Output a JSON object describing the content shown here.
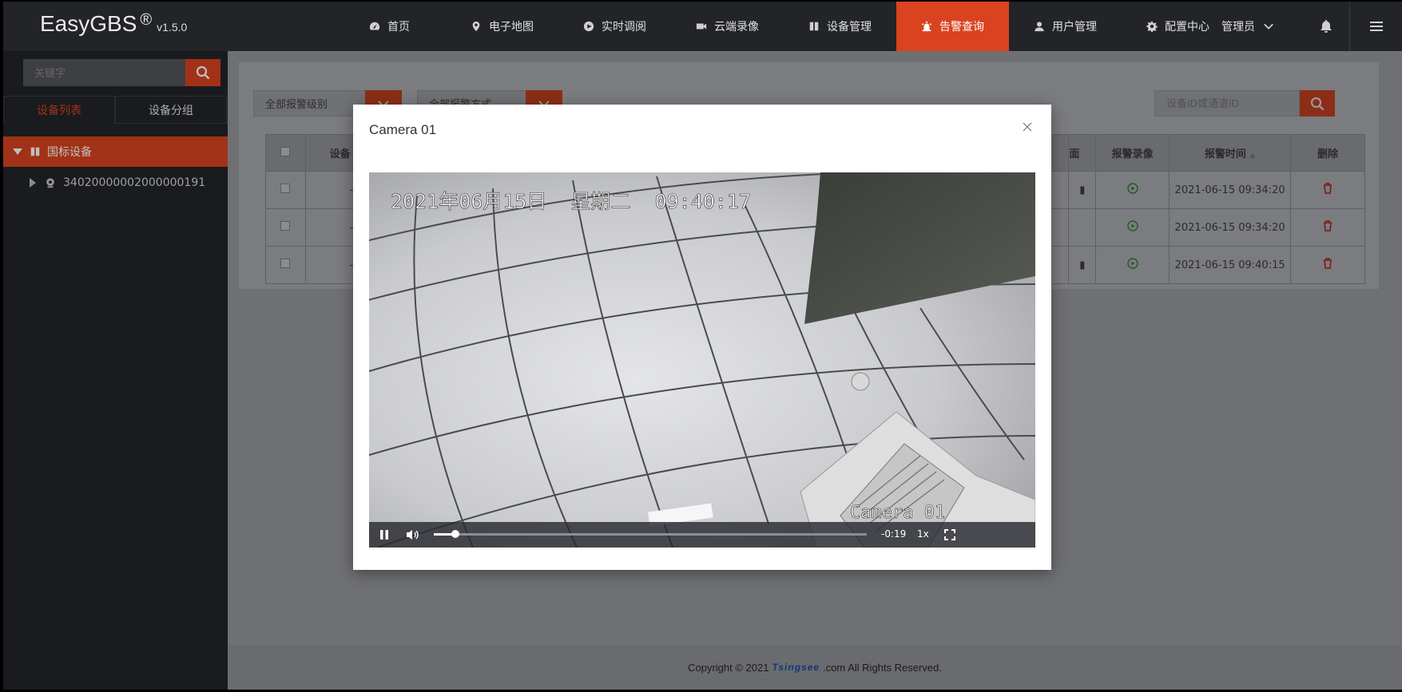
{
  "brand": {
    "name": "EasyGBS",
    "reg": "®",
    "version": "v1.5.0"
  },
  "nav": [
    {
      "label": "首页",
      "icon": "dashboard-icon"
    },
    {
      "label": "电子地图",
      "icon": "map-pin-icon"
    },
    {
      "label": "实时调阅",
      "icon": "play-circle-icon"
    },
    {
      "label": "云端录像",
      "icon": "video-camera-icon"
    },
    {
      "label": "设备管理",
      "icon": "book-icon"
    },
    {
      "label": "告警查询",
      "icon": "alarm-light-icon",
      "active": true
    },
    {
      "label": "用户管理",
      "icon": "user-icon"
    },
    {
      "label": "配置中心",
      "icon": "gear-icon"
    }
  ],
  "user": {
    "name": "管理员"
  },
  "sidebar": {
    "search_placeholder": "关键字",
    "tabs": [
      "设备列表",
      "设备分组"
    ],
    "tree_root": "国标设备",
    "tree_child": "34020000002000000191"
  },
  "filters": {
    "level": "全部报警级别",
    "method": "全部报警方式",
    "id_placeholder": "设备ID或通道ID"
  },
  "table": {
    "headers": {
      "device": "设备",
      "screen": "面",
      "record": "报警录像",
      "time": "报警时间",
      "delete": "删除"
    },
    "rows": [
      {
        "time": "2021-06-15 09:34:20"
      },
      {
        "time": "2021-06-15 09:34:20"
      },
      {
        "time": "2021-06-15 09:40:15"
      }
    ]
  },
  "footer": {
    "prefix": "Copyright © 2021",
    "brand": "Tsingsee",
    "suffix": ".com All Rights Reserved."
  },
  "modal": {
    "title": "Camera 01",
    "osd_datetime": "2021年06月15日  星期二  09:40:17",
    "osd_camera": "Camera 01",
    "time_remaining": "-0:19",
    "speed": "1x",
    "progress_fraction": 0.05
  },
  "colors": {
    "accent": "#d9431f",
    "navbar": "#222428",
    "sidebar": "#222428"
  }
}
